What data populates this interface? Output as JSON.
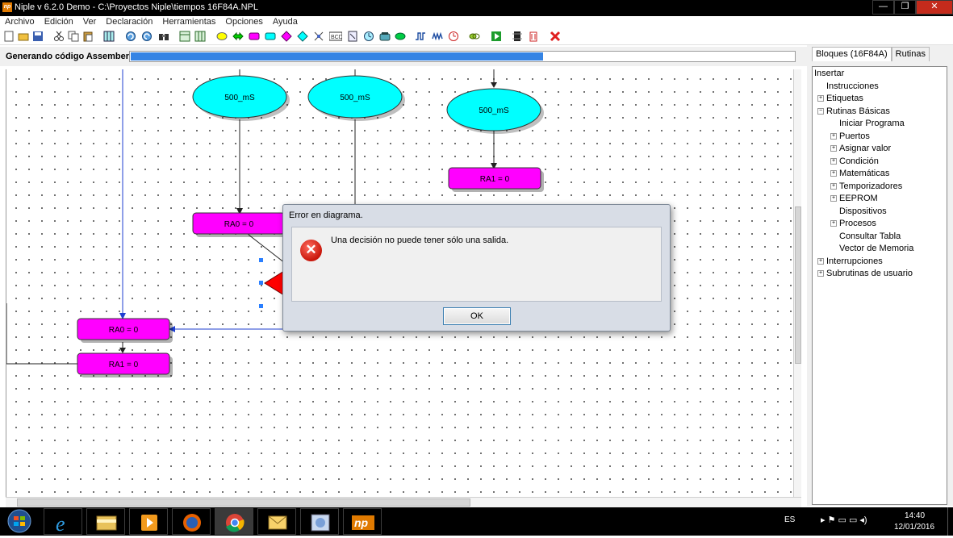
{
  "window": {
    "app_icon": "np",
    "title": "Niple v 6.2.0 Demo - C:\\Proyectos  Niple\\tiempos  16F84A.NPL",
    "buttons": {
      "minimize": "—",
      "maximize": "❐",
      "close": "✕"
    }
  },
  "menu": [
    "Archivo",
    "Edición",
    "Ver",
    "Declaración",
    "Herramientas",
    "Opciones",
    "Ayuda"
  ],
  "toolbar_icons": [
    "new-icon",
    "open-icon",
    "save-icon",
    "cut-icon",
    "copy-icon",
    "paste-icon",
    "grid-icon",
    "undo-icon",
    "redo-icon",
    "binoculars-icon",
    "panel-icon",
    "panel2-icon",
    "ellipse-icon",
    "arrow-block-icon",
    "process-block-icon",
    "subroutine-block-icon",
    "decision-icon",
    "diamond-icon",
    "data-icon",
    "bcd-icon",
    "bit-icon",
    "timer-icon",
    "phone-icon",
    "connector-icon",
    "pulse-icon",
    "wave-icon",
    "clock-icon",
    "chain-icon",
    "run-icon",
    "chip-icon",
    "delete-icon",
    "cancel-icon"
  ],
  "status": {
    "label": "Generando código Assember",
    "progress": 0.62
  },
  "diagram": {
    "blocks": [
      "500_mS",
      "500_mS",
      "500_mS",
      "RA1 = 0",
      "RA0 = 0",
      "RA0 = 0",
      "RA1 = 0"
    ]
  },
  "right_panel": {
    "tabs": [
      "Bloques (16F84A)",
      "Rutinas"
    ],
    "tree": [
      {
        "label": "Insertar",
        "level": 0,
        "exp": ""
      },
      {
        "label": "Instrucciones",
        "level": 1,
        "exp": ""
      },
      {
        "label": "Etiquetas",
        "level": 1,
        "exp": "+"
      },
      {
        "label": "Rutinas Básicas",
        "level": 1,
        "exp": "−"
      },
      {
        "label": "Iniciar Programa",
        "level": 2,
        "exp": ""
      },
      {
        "label": "Puertos",
        "level": 2,
        "exp": "+"
      },
      {
        "label": "Asignar valor",
        "level": 2,
        "exp": "+"
      },
      {
        "label": "Condición",
        "level": 2,
        "exp": "+"
      },
      {
        "label": "Matemáticas",
        "level": 2,
        "exp": "+"
      },
      {
        "label": "Temporizadores",
        "level": 2,
        "exp": "+"
      },
      {
        "label": "EEPROM",
        "level": 2,
        "exp": "+"
      },
      {
        "label": "Dispositivos",
        "level": 2,
        "exp": ""
      },
      {
        "label": "Procesos",
        "level": 2,
        "exp": "+"
      },
      {
        "label": "Consultar Tabla",
        "level": 2,
        "exp": ""
      },
      {
        "label": "Vector de Memoria",
        "level": 2,
        "exp": ""
      },
      {
        "label": "Interrupciones",
        "level": 1,
        "exp": "+"
      },
      {
        "label": "Subrutinas de usuario",
        "level": 1,
        "exp": "+"
      }
    ]
  },
  "dialog": {
    "title": "Error en diagrama.",
    "message": "Una decisión no puede tener sólo una salida.",
    "ok_label": "OK",
    "icon": "error-icon"
  },
  "taskbar": {
    "apps": [
      "ie-icon",
      "explorer-icon",
      "media-player-icon",
      "firefox-icon",
      "chrome-icon",
      "mail-icon",
      "photo-icon",
      "niple-icon"
    ],
    "lang": "ES",
    "time": "14:40",
    "date": "12/01/2016"
  },
  "colors": {
    "ellipse": "#00ffff",
    "block": "#ff00ff",
    "decision": "#ff0000",
    "flow_line": "#1f3fd0",
    "progress": "#3584e4"
  }
}
